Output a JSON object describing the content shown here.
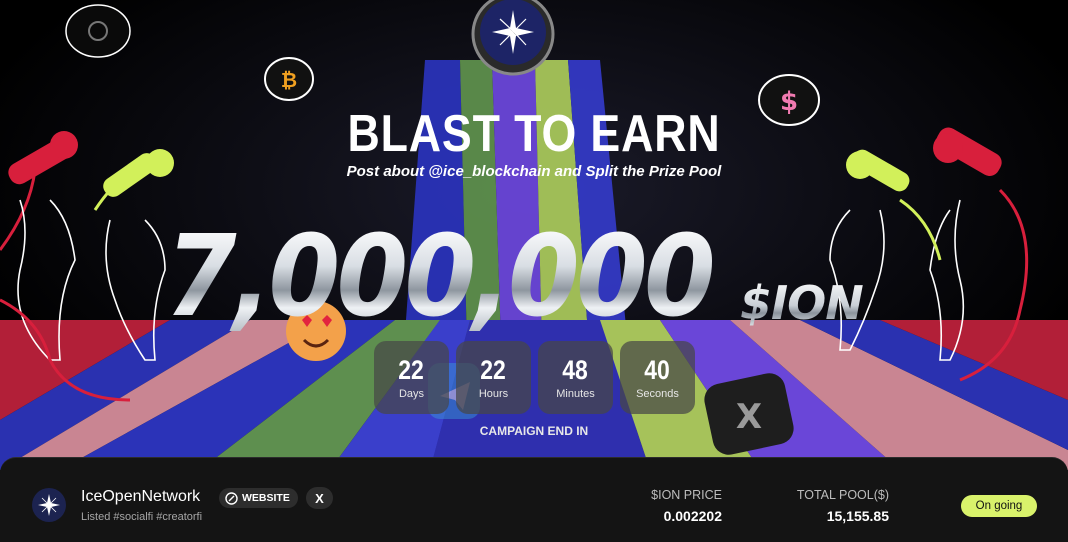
{
  "hero": {
    "title": "BLAST TO EARN",
    "subtitle": "Post about @ice_blockchain and Split the Prize Pool",
    "prize_amount": "7,000,000",
    "prize_unit": "$ION",
    "campaign_end_label": "CAMPAIGN END IN",
    "countdown": [
      {
        "value": "22",
        "label": "Days"
      },
      {
        "value": "22",
        "label": "Hours"
      },
      {
        "value": "48",
        "label": "Minutes"
      },
      {
        "value": "40",
        "label": "Seconds"
      }
    ],
    "coin_icons": [
      "bitcoin-coin-icon",
      "dollar-coin-icon",
      "ice-logo-coin-icon"
    ],
    "colors": {
      "stripe_red": "#c0223c",
      "stripe_pink": "#c98592",
      "stripe_blue": "#2b33b8",
      "stripe_green": "#5e8f4f",
      "stripe_purple": "#7547d6",
      "stripe_lime": "#a9c95a",
      "mic_red": "#d81f3c",
      "mic_lime": "#d2f05a"
    }
  },
  "project": {
    "name": "IceOpenNetwork",
    "tags": "Listed  #socialfi #creatorfi",
    "website_label": "WEBSITE",
    "x_label": "X",
    "price_label": "$ION PRICE",
    "price_value": "0.002202",
    "pool_label": "TOTAL POOL($)",
    "pool_value": "15,155.85",
    "status": "On going",
    "accent": "#d9f26b"
  }
}
